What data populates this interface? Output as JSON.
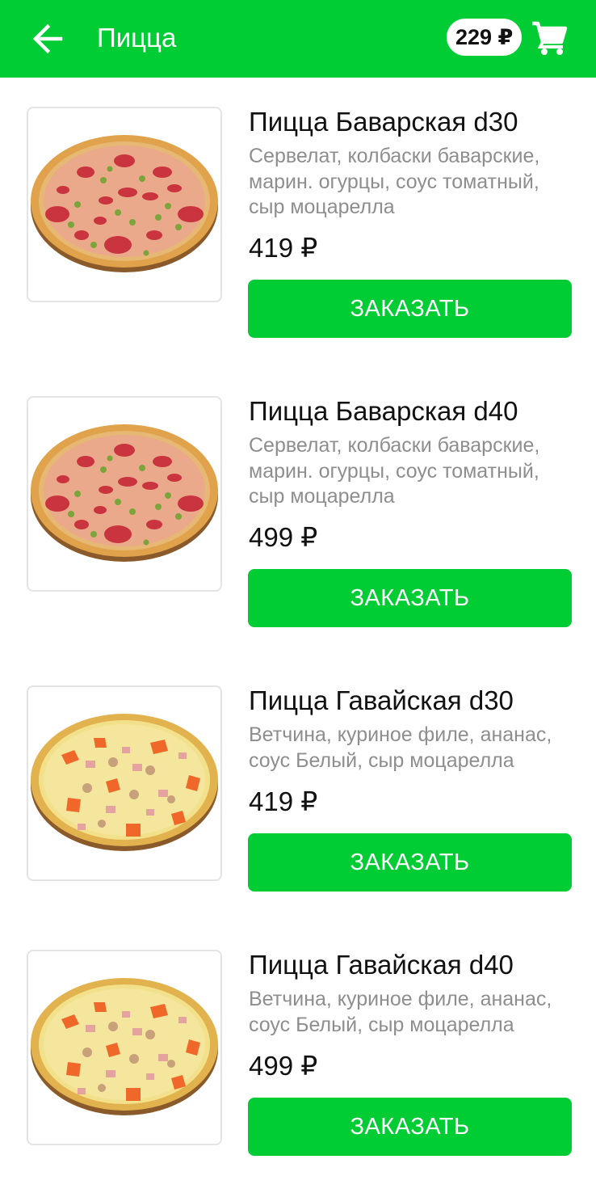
{
  "header": {
    "title": "Пицца",
    "cart_total": "229 ₽",
    "back_icon": "arrow-left-icon",
    "cart_icon": "shopping-cart-icon",
    "accent_color": "#00cc33"
  },
  "products": [
    {
      "name": "Пицца Баварская d30",
      "description": "Сервелат,  колбаски баварские, марин. огурцы, соус томатный, сыр моцарелла",
      "price": "419 ₽",
      "button": "ЗАКАЗАТЬ"
    },
    {
      "name": "Пицца Баварская d40",
      "description": "Сервелат,  колбаски баварские, марин. огурцы, соус томатный, сыр моцарелла",
      "price": "499 ₽",
      "button": "ЗАКАЗАТЬ"
    },
    {
      "name": "Пицца Гавайская d30",
      "description": "Ветчина, куриное филе, ананас, соус Белый, сыр моцарелла",
      "price": "419 ₽",
      "button": "ЗАКАЗАТЬ"
    },
    {
      "name": "Пицца Гавайская d40",
      "description": "Ветчина, куриное филе, ананас, соус Белый, сыр моцарелла",
      "price": "499 ₽",
      "button": "ЗАКАЗАТЬ"
    }
  ]
}
